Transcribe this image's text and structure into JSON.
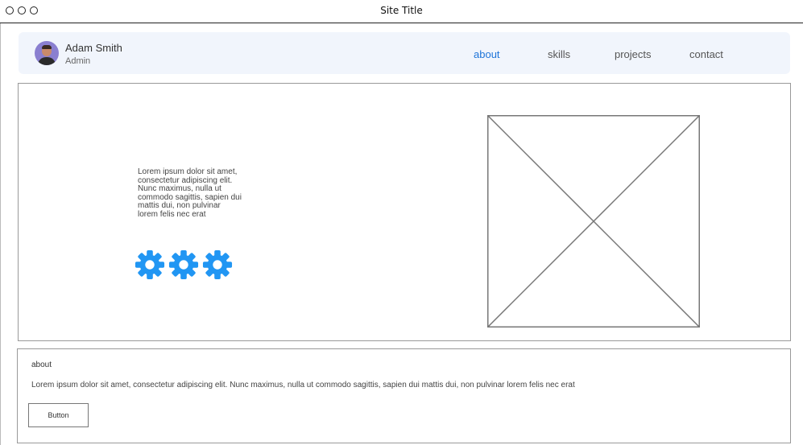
{
  "window": {
    "title": "Site Title"
  },
  "user": {
    "name": "Adam Smith",
    "role": "Admin"
  },
  "nav": {
    "items": [
      {
        "label": "about",
        "active": true
      },
      {
        "label": "skills",
        "active": false
      },
      {
        "label": "projects",
        "active": false
      },
      {
        "label": "contact",
        "active": false
      }
    ]
  },
  "hero": {
    "text": "Lorem ipsum dolor sit amet, consectetur adipiscing elit. Nunc maximus, nulla ut commodo sagittis, sapien dui mattis dui, non pulvinar lorem felis nec erat",
    "icons": [
      "gear-icon",
      "gear-icon",
      "gear-icon"
    ],
    "icon_color": "#2196f3",
    "image": "image-placeholder"
  },
  "about": {
    "heading": "about",
    "body": "Lorem ipsum dolor sit amet, consectetur adipiscing elit. Nunc maximus, nulla ut commodo sagittis, sapien dui mattis dui, non pulvinar lorem felis nec erat",
    "button_label": "Button"
  },
  "colors": {
    "accent": "#1e74d8",
    "nav_background": "#f1f5fc",
    "border": "#999999"
  }
}
